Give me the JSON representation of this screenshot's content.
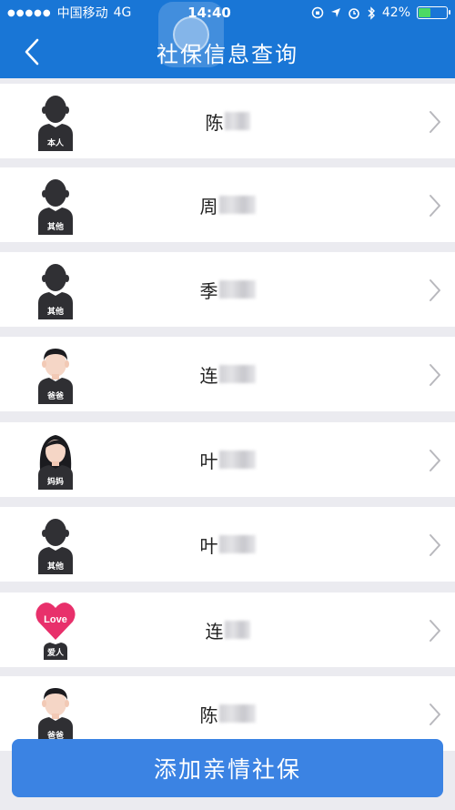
{
  "status": {
    "carrier": "中国移动",
    "network": "4G",
    "time": "14:40",
    "battery": "42%",
    "battery_level": 0.42
  },
  "nav": {
    "title": "社保信息查询"
  },
  "members": [
    {
      "label": "本人",
      "surname": "陈",
      "avatar": "silhouette"
    },
    {
      "label": "其他",
      "surname": "周",
      "avatar": "silhouette"
    },
    {
      "label": "其他",
      "surname": "季",
      "avatar": "silhouette"
    },
    {
      "label": "爸爸",
      "surname": "连",
      "avatar": "father"
    },
    {
      "label": "妈妈",
      "surname": "叶",
      "avatar": "mother"
    },
    {
      "label": "其他",
      "surname": "叶",
      "avatar": "silhouette"
    },
    {
      "label": "爱人",
      "surname": "连",
      "avatar": "heart",
      "heart_text": "Love"
    },
    {
      "label": "爸爸",
      "surname": "陈",
      "avatar": "father"
    }
  ],
  "add_button": "添加亲情社保",
  "colors": {
    "header": "#1976d6",
    "button": "#3b83e3",
    "background": "#ebebf0",
    "heart": "#e8306b"
  }
}
